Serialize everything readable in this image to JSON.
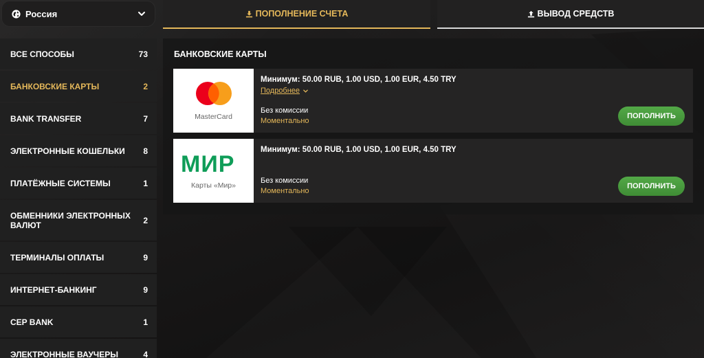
{
  "country_selector": {
    "label": "Россия"
  },
  "tabs": {
    "deposit": "ПОПОЛНЕНИЕ СЧЕТА",
    "withdraw": "ВЫВОД СРЕДСТВ"
  },
  "menu": [
    {
      "label": "ВСЕ СПОСОБЫ",
      "count": "73",
      "active": false
    },
    {
      "label": "БАНКОВСКИЕ КАРТЫ",
      "count": "2",
      "active": true
    },
    {
      "label": "BANK TRANSFER",
      "count": "7",
      "active": false
    },
    {
      "label": "ЭЛЕКТРОННЫЕ КОШЕЛЬКИ",
      "count": "8",
      "active": false
    },
    {
      "label": "ПЛАТЁЖНЫЕ СИСТЕМЫ",
      "count": "1",
      "active": false
    },
    {
      "label": "ОБМЕННИКИ ЭЛЕКТРОННЫХ ВАЛЮТ",
      "count": "2",
      "active": false
    },
    {
      "label": "ТЕРМИНАЛЫ ОПЛАТЫ",
      "count": "9",
      "active": false
    },
    {
      "label": "ИНТЕРНЕТ-БАНКИНГ",
      "count": "9",
      "active": false
    },
    {
      "label": "CEP BANK",
      "count": "1",
      "active": false
    },
    {
      "label": "ЭЛЕКТРОННЫЕ ВАУЧЕРЫ",
      "count": "4",
      "active": false
    }
  ],
  "section": {
    "title": "БАНКОВСКИЕ КАРТЫ"
  },
  "methods": [
    {
      "logo_caption": "MasterCard",
      "minimum": "Минимум: 50.00 RUB, 1.00 USD, 1.00 EUR, 4.50 TRY",
      "more_label": "Подробнее",
      "fee": "Без комиссии",
      "speed": "Моментально",
      "button": "ПОПОЛНИТЬ"
    },
    {
      "logo_text": "МИР",
      "logo_caption": "Карты «Мир»",
      "minimum": "Минимум: 50.00 RUB, 1.00 USD, 1.00 EUR, 4.50 TRY",
      "fee": "Без комиссии",
      "speed": "Моментально",
      "button": "ПОПОЛНИТЬ"
    }
  ],
  "colors": {
    "accent_gold": "#e5b85a",
    "button_green": "#4a9b3e",
    "panel": "#202020",
    "mastercard_red": "#eb001b",
    "mastercard_orange": "#f79e1b",
    "mir_green": "#0f9d58"
  },
  "icons": {
    "country": "globe-icon",
    "country_dropdown": "chevron-down-icon",
    "deposit_tab": "download-icon",
    "withdraw_tab": "upload-icon",
    "more": "chevron-down-icon"
  }
}
